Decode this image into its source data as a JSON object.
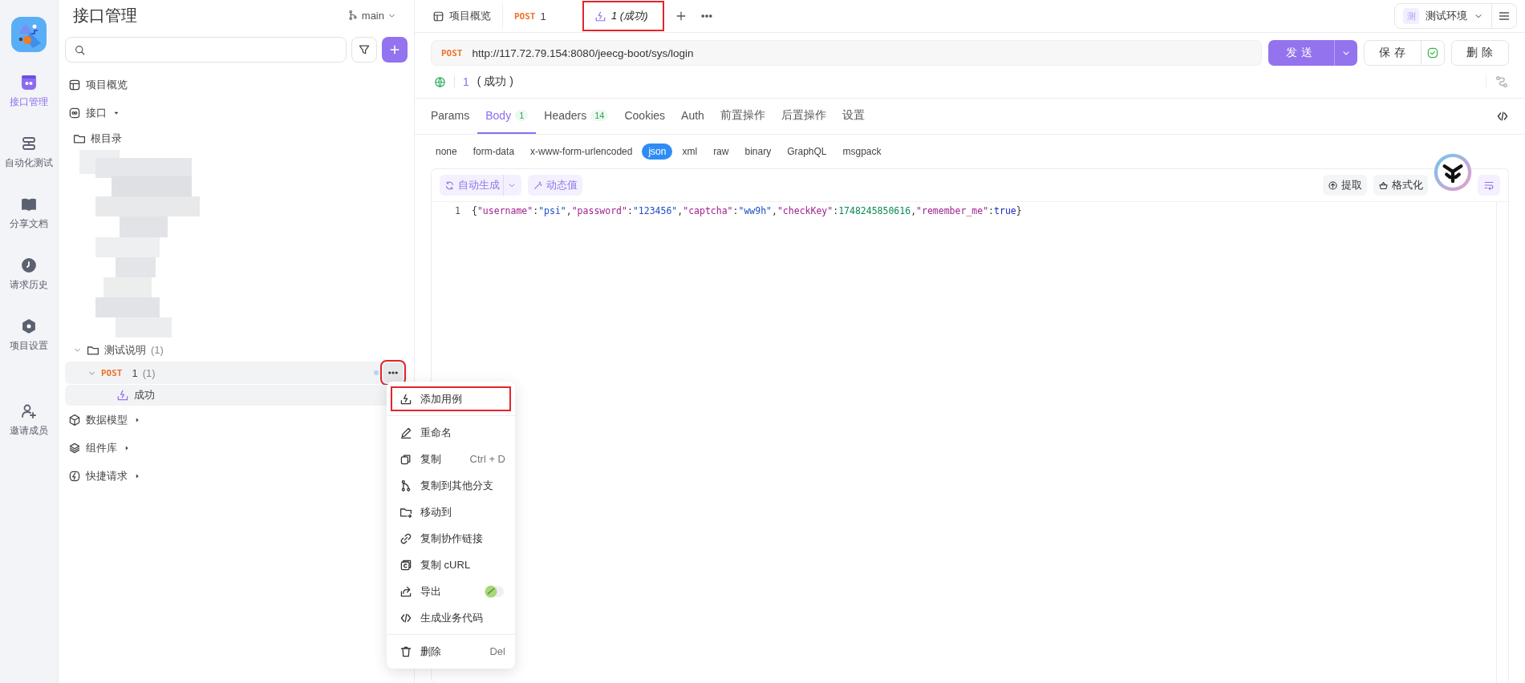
{
  "nav_rail": {
    "items": [
      {
        "label": "接口管理",
        "selected": true
      },
      {
        "label": "自动化测试",
        "selected": false
      },
      {
        "label": "分享文档",
        "selected": false
      },
      {
        "label": "请求历史",
        "selected": false
      },
      {
        "label": "项目设置",
        "selected": false
      },
      {
        "label": "邀请成员",
        "selected": false
      }
    ]
  },
  "sidebar": {
    "title": "接口管理",
    "branch": "main",
    "tree": [
      {
        "kind": "overview",
        "label": "项目概览"
      },
      {
        "kind": "section",
        "label": "接口",
        "expanded": true,
        "children": [
          {
            "kind": "folder",
            "label": "根目录"
          },
          {
            "kind": "blurred"
          },
          {
            "kind": "folder",
            "label": "测试说明",
            "count": "(1)",
            "expanded": true,
            "children": [
              {
                "kind": "request",
                "method": "POST",
                "label": "1",
                "count": "(1)",
                "expanded": true,
                "hovered": true,
                "annotated": true,
                "children": [
                  {
                    "kind": "case",
                    "label": "成功",
                    "selected": true
                  }
                ]
              }
            ]
          }
        ]
      },
      {
        "kind": "section",
        "label": "数据模型",
        "expanded": false
      },
      {
        "kind": "section",
        "label": "组件库",
        "expanded": false
      },
      {
        "kind": "section",
        "label": "快捷请求",
        "expanded": false
      }
    ]
  },
  "tabs": [
    {
      "kind": "overview",
      "label": "项目概览",
      "selected": false,
      "annotated": false
    },
    {
      "kind": "request",
      "method": "POST",
      "label": "1",
      "selected": false,
      "annotated": false
    },
    {
      "kind": "case",
      "label": "1 (成功)",
      "selected": true,
      "annotated": true
    }
  ],
  "environment": {
    "badge": "测",
    "label": "测试环境"
  },
  "request": {
    "method": "POST",
    "url": "http://117.72.79.154:8080/jeecg-boot/sys/login",
    "send": "发送",
    "save": "保存",
    "saved": true,
    "delete": "删除",
    "case_id": "1",
    "case_name": "( 成功 )"
  },
  "param_tabs": [
    {
      "label": "Params",
      "selected": false
    },
    {
      "label": "Body",
      "count": "1",
      "selected": true
    },
    {
      "label": "Headers",
      "count": "14",
      "selected": false
    },
    {
      "label": "Cookies",
      "selected": false
    },
    {
      "label": "Auth",
      "selected": false
    },
    {
      "label": "前置操作",
      "selected": false
    },
    {
      "label": "后置操作",
      "selected": false
    },
    {
      "label": "设置",
      "selected": false
    }
  ],
  "body_types": [
    {
      "label": "none",
      "selected": false
    },
    {
      "label": "form-data",
      "selected": false
    },
    {
      "label": "x-www-form-urlencoded",
      "selected": false
    },
    {
      "label": "json",
      "selected": true
    },
    {
      "label": "xml",
      "selected": false
    },
    {
      "label": "raw",
      "selected": false
    },
    {
      "label": "binary",
      "selected": false
    },
    {
      "label": "GraphQL",
      "selected": false
    },
    {
      "label": "msgpack",
      "selected": false
    }
  ],
  "editor": {
    "auto_generate": "自动生成",
    "dynamic_value": "动态值",
    "extract": "提取",
    "format": "格式化",
    "lines": [
      {
        "number": "1",
        "code": "{\"username\":\"psi\",\"password\":\"123456\",\"captcha\":\"ww9h\",\"checkKey\":1748245850616,\"remember_me\":true}"
      }
    ]
  },
  "context_menu": {
    "groups": [
      {
        "items": [
          {
            "label": "添加用例",
            "annotated": true
          }
        ]
      },
      {
        "items": [
          {
            "label": "重命名"
          },
          {
            "label": "复制",
            "shortcut": "Ctrl + D"
          },
          {
            "label": "复制到其他分支"
          },
          {
            "label": "移动到"
          },
          {
            "label": "复制协作链接"
          },
          {
            "label": "复制 cURL"
          },
          {
            "label": "导出",
            "extra": true
          },
          {
            "label": "生成业务代码"
          }
        ]
      },
      {
        "items": [
          {
            "label": "删除",
            "shortcut": "Del"
          }
        ]
      }
    ]
  }
}
